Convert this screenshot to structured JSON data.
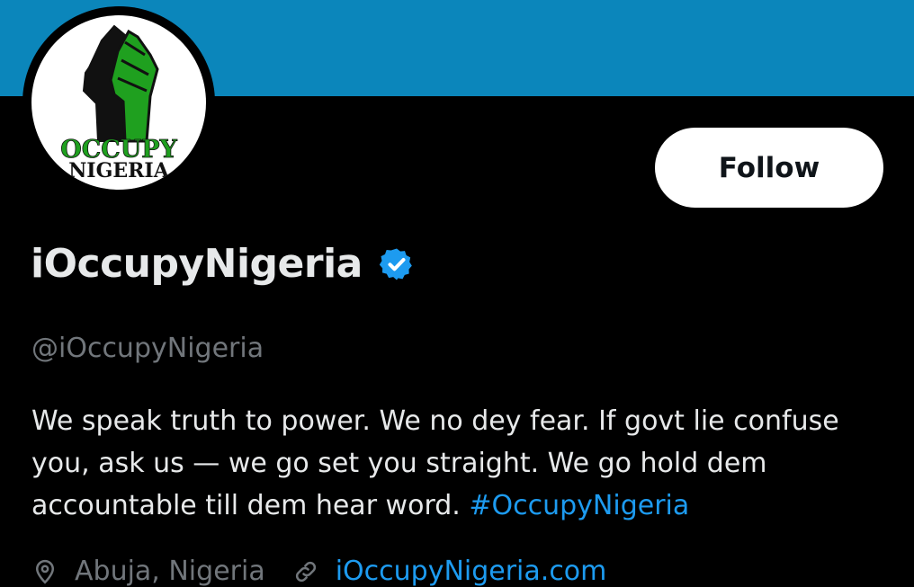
{
  "profile": {
    "logo_text_top": "OCCUPY",
    "logo_text_bottom": "NIGERIA",
    "follow_label": "Follow",
    "display_name": "iOccupyNigeria",
    "handle": "@iOccupyNigeria",
    "bio_text": "We speak truth to power. We no dey fear. If govt lie confuse you, ask us — we go set you straight. We go hold dem accountable till dem hear word. ",
    "bio_hashtag": "#OccupyNigeria",
    "location": "Abuja, Nigeria",
    "website": "iOccupyNigeria.com"
  },
  "colors": {
    "banner": "#0b86bb",
    "background": "#000000",
    "accent_link": "#1d9bf0",
    "verified_badge": "#1d9bf0",
    "logo_green": "#1fa01f"
  },
  "icons": [
    "verified-badge-icon",
    "location-icon",
    "link-icon"
  ]
}
